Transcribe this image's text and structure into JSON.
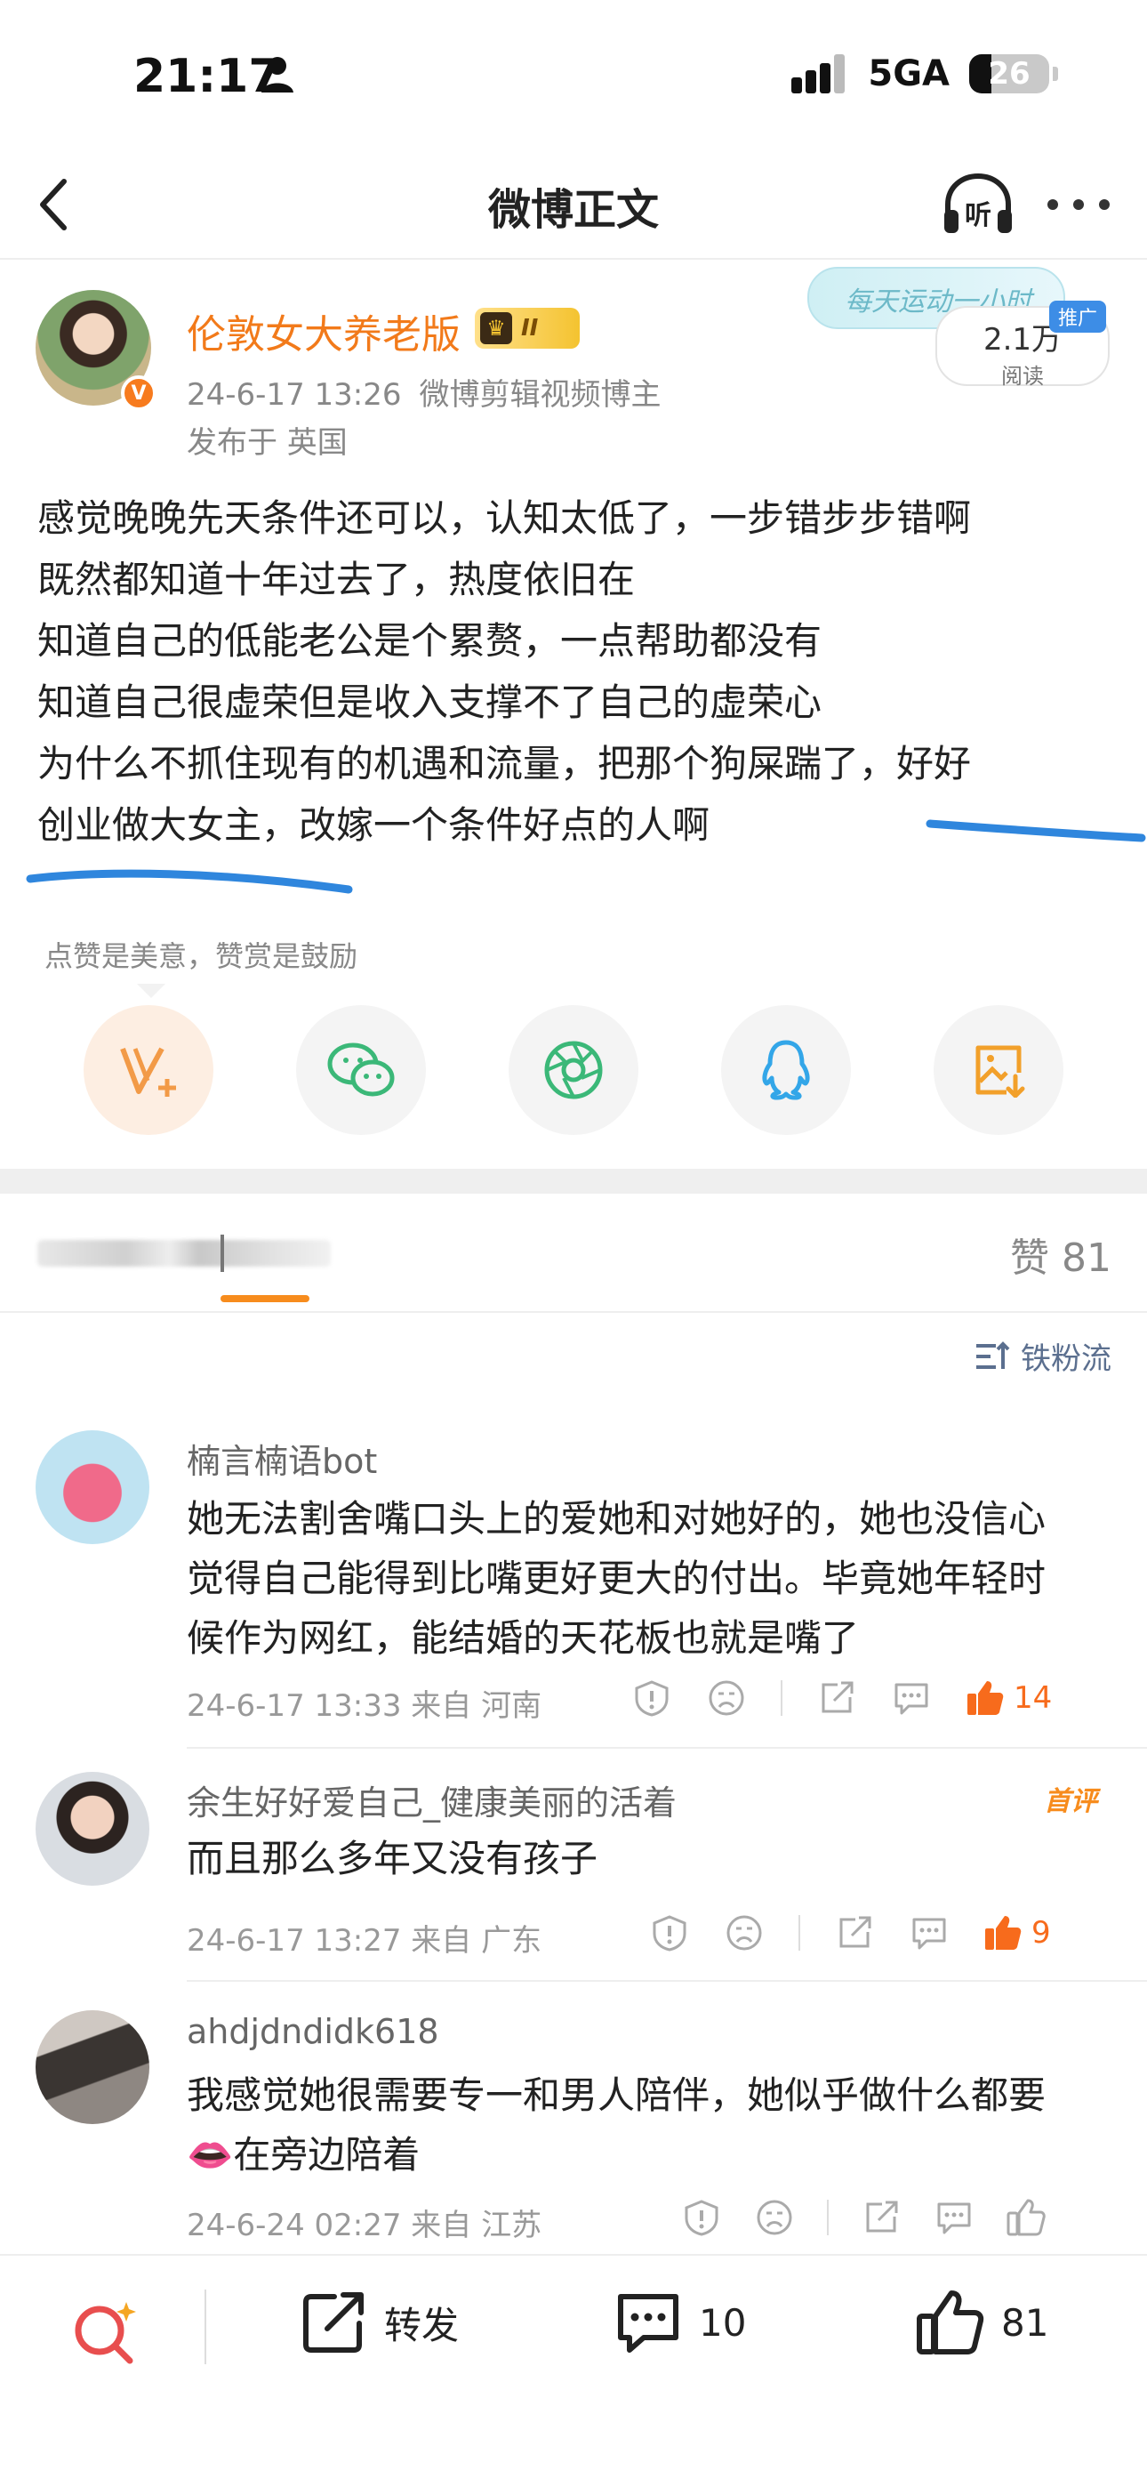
{
  "status_bar": {
    "time": "21:17",
    "network": "5GA",
    "battery": "26"
  },
  "nav": {
    "title": "微博正文"
  },
  "post": {
    "author": "伦敦女大养老版",
    "vip_level": "II",
    "timestamp": "24-6-17 13:26",
    "source": "微博剪辑视频博主",
    "location": "发布于 英国",
    "read_count": "2.1万",
    "read_label": "阅读",
    "promo_text": "每天运动一小时",
    "promo_tag": "推广",
    "body_lines": [
      "感觉晚晚先天条件还可以，认知太低了，一步错步步错啊",
      "既然都知道十年过去了，热度依旧在",
      "知道自己的低能老公是个累赘，一点帮助都没有",
      "知道自己很虚荣但是收入支撑不了自己的虚荣心",
      "为什么不抓住现有的机遇和流量，把那个狗屎踹了，好好",
      "创业做大女主，改嫁一个条件好点的人啊"
    ],
    "reward_tip": "点赞是美意，赞赏是鼓励"
  },
  "tabs": {
    "likes_total": "赞 81"
  },
  "sort": {
    "label": "铁粉流"
  },
  "comments": [
    {
      "name": "楠言楠语bot",
      "lines": [
        "她无法割舍嘴口头上的爱她和对她好的，她也没信心",
        "觉得自己能得到比嘴更好更大的付出。毕竟她年轻时",
        "候作为网红，能结婚的天花板也就是嘴了"
      ],
      "meta": "24-6-17 13:33 来自 河南",
      "likes": "14"
    },
    {
      "name": "余生好好爱自己_健康美丽的活着",
      "tag": "首评",
      "lines": [
        "而且那么多年又没有孩子"
      ],
      "meta": "24-6-17 13:27 来自 广东",
      "likes": "9"
    },
    {
      "name": "ahdjdndidk618",
      "lines": [
        "我感觉她很需要专一和男人陪伴，她似乎做什么都要",
        "👄在旁边陪着"
      ],
      "meta": "24-6-24 02:27 来自 江苏",
      "likes": ""
    }
  ],
  "bottom_bar": {
    "repost_label": "转发",
    "comment_count": "10",
    "like_count": "81"
  },
  "colors": {
    "accent_orange": "#f27a1a",
    "link_blue": "#5b6f8f",
    "annotation_blue": "#2f86dd"
  }
}
